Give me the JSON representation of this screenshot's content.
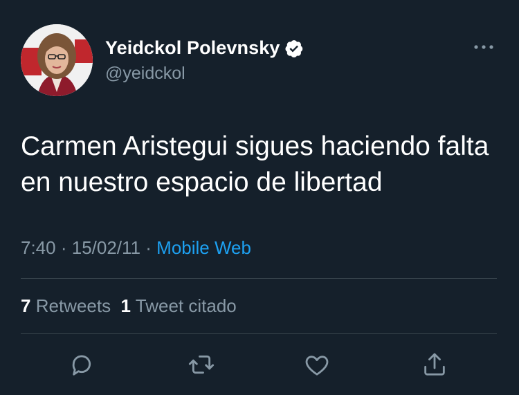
{
  "tweet": {
    "display_name": "Yeidckol Polevnsky",
    "handle": "@yeidckol",
    "text": "Carmen Aristegui sigues haciendo falta en nuestro espacio de libertad",
    "time": "7:40",
    "date": "15/02/11",
    "separator": "·",
    "source": "Mobile Web",
    "retweets_count": "7",
    "retweets_label": "Retweets",
    "quotes_count": "1",
    "quotes_label": "Tweet citado"
  },
  "icons": {
    "verified": "verified-badge-icon",
    "more": "more-options-icon",
    "reply": "reply-icon",
    "retweet": "retweet-icon",
    "like": "like-icon",
    "share": "share-icon"
  },
  "colors": {
    "background": "#15202b",
    "text": "#ffffff",
    "secondary": "#8899a6",
    "link": "#1da1f2",
    "divider": "#38444d"
  }
}
